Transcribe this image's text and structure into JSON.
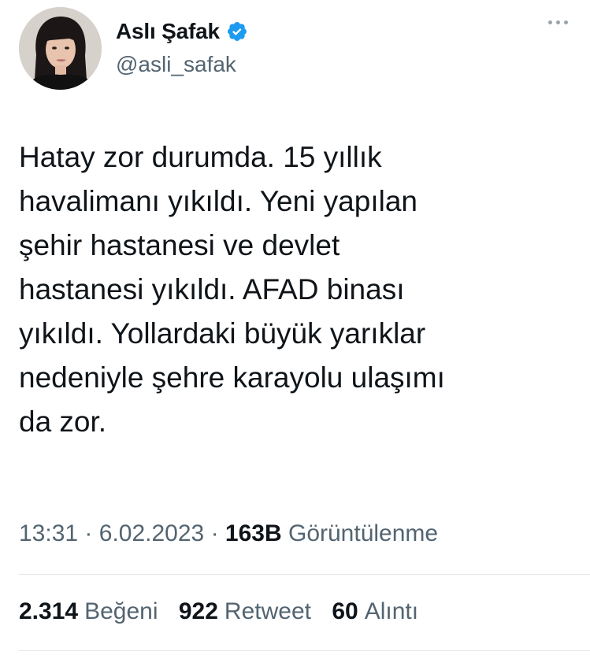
{
  "author": {
    "display_name": "Aslı Şafak",
    "handle": "@asli_safak",
    "verified": true,
    "verified_color": "#1d9bf0"
  },
  "tweet": {
    "text": "Hatay zor durumda. 15 yıllık\nhavalimanı yıkıldı. Yeni yapılan\nşehir hastanesi ve devlet\nhastanesi yıkıldı. AFAD binası\nyıkıldı. Yollardaki büyük yarıklar\nnedeniyle şehre karayolu ulaşımı\nda zor.",
    "time": "13:31",
    "separator": "·",
    "date": "6.02.2023",
    "views_count": "163B",
    "views_label": "Görüntülenme"
  },
  "stats": {
    "likes_count": "2.314",
    "likes_label": "Beğeni",
    "retweets_count": "922",
    "retweets_label": "Retweet",
    "quotes_count": "60",
    "quotes_label": "Alıntı"
  },
  "icons": {
    "more": "more-dots-icon",
    "verified": "verified-badge-icon"
  }
}
